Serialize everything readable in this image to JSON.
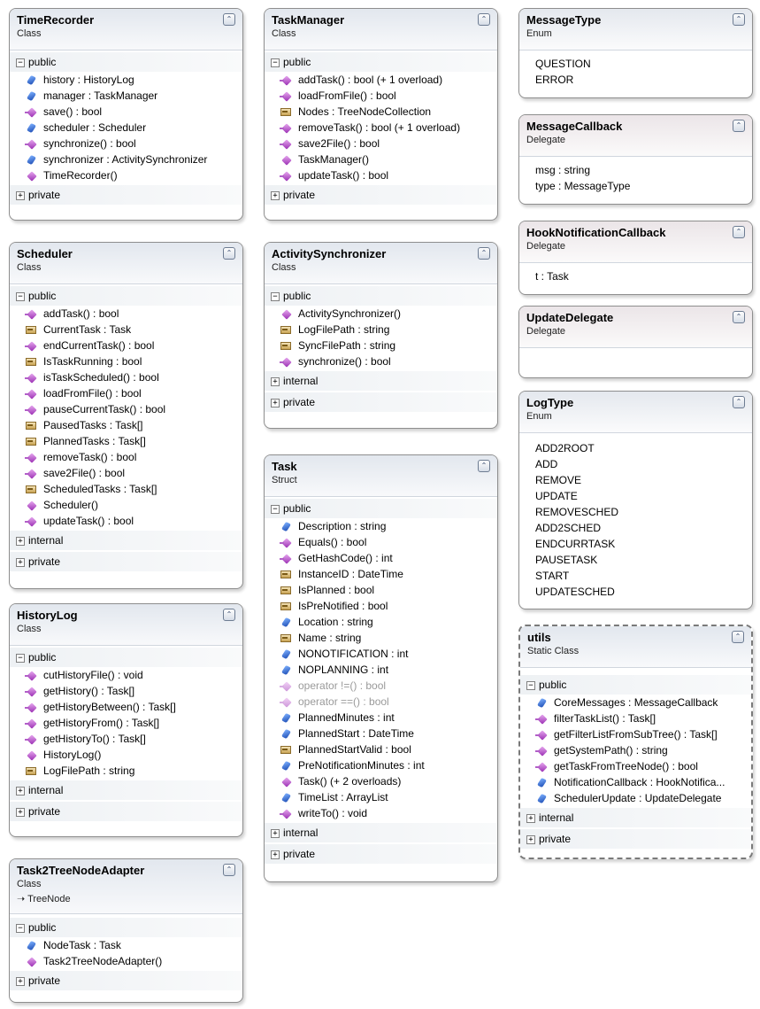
{
  "boxes": {
    "timerecorder": {
      "title": "TimeRecorder",
      "stereo": "Class",
      "public": "public",
      "private": "private",
      "members": [
        "history : HistoryLog",
        "manager : TaskManager",
        "save() : bool",
        "scheduler : Scheduler",
        "synchronize() : bool",
        "synchronizer : ActivitySynchronizer",
        "TimeRecorder()"
      ]
    },
    "taskmanager": {
      "title": "TaskManager",
      "stereo": "Class",
      "public": "public",
      "private": "private",
      "members": [
        "addTask() : bool (+ 1 overload)",
        "loadFromFile() : bool",
        "Nodes : TreeNodeCollection",
        "removeTask() : bool (+ 1 overload)",
        "save2File() : bool",
        "TaskManager()",
        "updateTask() : bool"
      ]
    },
    "messagetype": {
      "title": "MessageType",
      "stereo": "Enum",
      "values": [
        "QUESTION",
        "ERROR"
      ]
    },
    "messagecallback": {
      "title": "MessageCallback",
      "stereo": "Delegate",
      "params": [
        "msg : string",
        "type : MessageType"
      ]
    },
    "hookcallback": {
      "title": "HookNotificationCallback",
      "stereo": "Delegate",
      "params": [
        "t : Task"
      ]
    },
    "updatedelegate": {
      "title": "UpdateDelegate",
      "stereo": "Delegate"
    },
    "logtype": {
      "title": "LogType",
      "stereo": "Enum",
      "values": [
        "ADD2ROOT",
        "ADD",
        "REMOVE",
        "UPDATE",
        "REMOVESCHED",
        "ADD2SCHED",
        "ENDCURRTASK",
        "PAUSETASK",
        "START",
        "UPDATESCHED"
      ]
    },
    "scheduler": {
      "title": "Scheduler",
      "stereo": "Class",
      "public": "public",
      "internal": "internal",
      "private": "private",
      "members": [
        "addTask() : bool",
        "CurrentTask : Task",
        "endCurrentTask() : bool",
        "IsTaskRunning : bool",
        "isTaskScheduled() : bool",
        "loadFromFile() : bool",
        "pauseCurrentTask() : bool",
        "PausedTasks : Task[]",
        "PlannedTasks : Task[]",
        "removeTask() : bool",
        "save2File() : bool",
        "ScheduledTasks : Task[]",
        "Scheduler()",
        "updateTask() : bool"
      ]
    },
    "activitysync": {
      "title": "ActivitySynchronizer",
      "stereo": "Class",
      "public": "public",
      "internal": "internal",
      "private": "private",
      "members": [
        "ActivitySynchronizer()",
        "LogFilePath : string",
        "SyncFilePath : string",
        "synchronize() : bool"
      ]
    },
    "task": {
      "title": "Task",
      "stereo": "Struct",
      "public": "public",
      "internal": "internal",
      "private": "private",
      "members": [
        "Description : string",
        "Equals() : bool",
        "GetHashCode() : int",
        "InstanceID : DateTime",
        "IsPlanned : bool",
        "IsPreNotified : bool",
        "Location : string",
        "Name : string",
        "NONOTIFICATION : int",
        "NOPLANNING : int",
        "operator !=() : bool",
        "operator ==() : bool",
        "PlannedMinutes : int",
        "PlannedStart : DateTime",
        "PlannedStartValid : bool",
        "PreNotificationMinutes : int",
        "Task() (+ 2 overloads)",
        "TimeList : ArrayList",
        "writeTo() : void"
      ]
    },
    "historylog": {
      "title": "HistoryLog",
      "stereo": "Class",
      "public": "public",
      "internal": "internal",
      "private": "private",
      "members": [
        "cutHistoryFile() : void",
        "getHistory() : Task[]",
        "getHistoryBetween() : Task[]",
        "getHistoryFrom() : Task[]",
        "getHistoryTo() : Task[]",
        "HistoryLog()",
        "LogFilePath : string"
      ]
    },
    "utils": {
      "title": "utils",
      "stereo": "Static Class",
      "public": "public",
      "internal": "internal",
      "private": "private",
      "members": [
        "CoreMessages : MessageCallback",
        "filterTaskList() : Task[]",
        "getFilterListFromSubTree() : Task[]",
        "getSystemPath() : string",
        "getTaskFromTreeNode() : bool",
        "NotificationCallback : HookNotifica...",
        "SchedulerUpdate : UpdateDelegate"
      ]
    },
    "adapter": {
      "title": "Task2TreeNodeAdapter",
      "stereo": "Class",
      "base": "TreeNode",
      "public": "public",
      "private": "private",
      "members": [
        "NodeTask : Task",
        "Task2TreeNodeAdapter()"
      ]
    }
  },
  "glyphs": {
    "collapse": "⌃⌃",
    "minus": "−",
    "plus": "+",
    "base_arrow": "➝"
  }
}
